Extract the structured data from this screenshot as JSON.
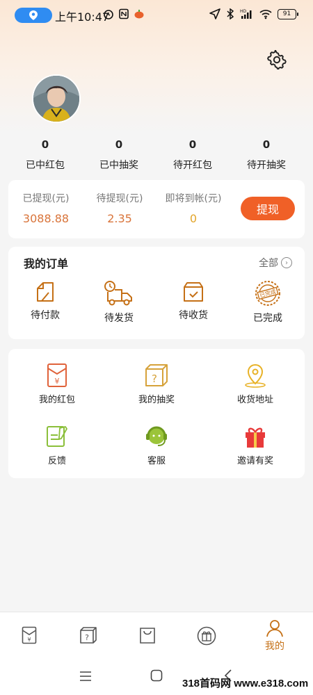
{
  "status_bar": {
    "time": "上午10:47",
    "battery": "91"
  },
  "stats": [
    {
      "value": "0",
      "label": "已中红包"
    },
    {
      "value": "0",
      "label": "已中抽奖"
    },
    {
      "value": "0",
      "label": "待开红包"
    },
    {
      "value": "0",
      "label": "待开抽奖"
    }
  ],
  "wallet": {
    "withdrawn_label": "已提现(元)",
    "withdrawn_value": "3088.88",
    "pending_label": "待提现(元)",
    "pending_value": "2.35",
    "incoming_label": "即将到帐(元)",
    "incoming_value": "0",
    "withdraw_button": "提现",
    "colors": {
      "value": "#d9743a",
      "button": "#f06027",
      "incoming": "#e2a52a"
    }
  },
  "orders": {
    "title": "我的订单",
    "all_label": "全部",
    "items": [
      {
        "label": "待付款",
        "icon": "wallet-icon"
      },
      {
        "label": "待发货",
        "icon": "delivery-truck-icon"
      },
      {
        "label": "待收货",
        "icon": "package-box-icon"
      },
      {
        "label": "已完成",
        "icon": "completed-stamp-icon",
        "stamp_text": "已完成"
      }
    ]
  },
  "services": [
    {
      "label": "我的红包",
      "icon": "red-envelope-icon"
    },
    {
      "label": "我的抽奖",
      "icon": "mystery-box-icon"
    },
    {
      "label": "收货地址",
      "icon": "location-pin-icon"
    },
    {
      "label": "反馈",
      "icon": "feedback-icon"
    },
    {
      "label": "客服",
      "icon": "customer-service-icon"
    },
    {
      "label": "邀请有奖",
      "icon": "gift-icon"
    }
  ],
  "bottom_nav": {
    "active_label": "我的",
    "items": [
      "red-envelope-icon",
      "mystery-box-icon",
      "shopping-bag-icon",
      "gift-icon",
      "profile-icon"
    ]
  },
  "watermark": "318首码网 www.e318.com",
  "accent_color": "#c57016"
}
